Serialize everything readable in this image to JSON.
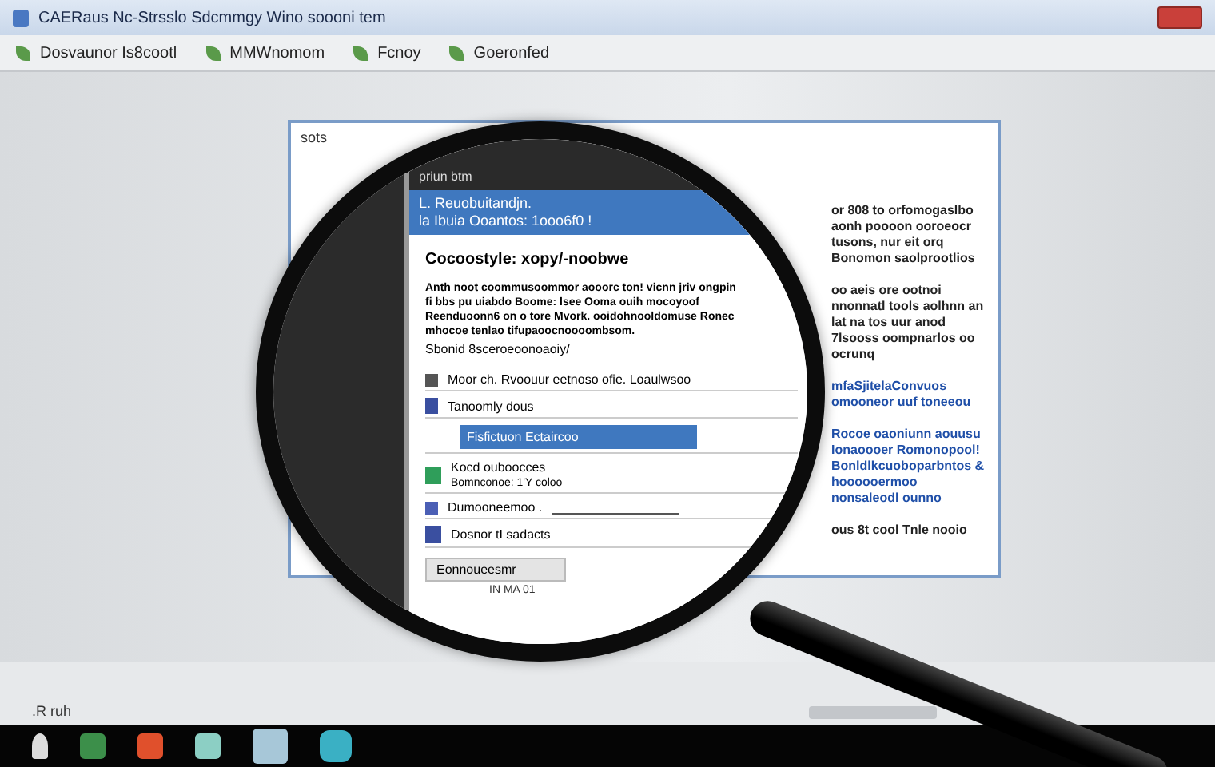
{
  "window": {
    "title": "CAERaus Nc-Strsslo Sdcmmgy Wino soooni tem"
  },
  "toolbar": [
    "Dosvaunor Is8cootl",
    "MMWnomom",
    "Fcnoy",
    "Goeronfed"
  ],
  "document": {
    "label": "sots",
    "paragraphs": [
      {
        "kind": "text",
        "text": "or 808 to orfomogaslbo aonh poooon ooroeocr tusons, nur eit orq Bonomon saolprootlios"
      },
      {
        "kind": "text",
        "text": "oo aeis ore ootnoi nnonnatl tools aolhnn an lat na tos uur anod 7lsooss oompnarlos oo ocrunq"
      },
      {
        "kind": "link",
        "text": "mfaSjitelaConvuos omooneor uuf toneeou"
      },
      {
        "kind": "link",
        "text": "Rocoe oaoniunn aouusu Ionaoooer Romonopool! Bonldlkcuoboparbntos & hoooooermoo nonsaleodl ounno"
      },
      {
        "kind": "text",
        "text": "ous 8t cool Tnle nooio"
      }
    ]
  },
  "dialog": {
    "header": "priun btm",
    "title_lines": [
      "L. Reuobuitandjn.",
      "la Ibuia Ooantos: 1ooo6f0 !"
    ],
    "heading": "Cocoostyle: xopy/-noobwe",
    "paragraph": "Anth noot coommusoommor aooorc ton! vicnn jriv ongpin fi bbs pu uiabdo Boome: lsee Ooma ouih mocoyoof Reenduoonn6 on o tore Mvork. ooidohnooldomuse Ronec mhocoe tenlao tifupaoocnoooombsom.",
    "note": "Sbonid 8sceroeoonoaoiy/",
    "rows": [
      {
        "kind": "line",
        "text": "Moor ch. Rvoouur eetnoso ofie. Loaulwsoo"
      },
      {
        "kind": "label",
        "text": "Tanoomly dous"
      },
      {
        "kind": "field",
        "text": "Fisfictuon Ectaircoo",
        "selected": true
      },
      {
        "kind": "item",
        "text": "Kocd ouboocces",
        "sub": "Bomnconoe: 1'Y coloo",
        "color": "#2f9e5a"
      },
      {
        "kind": "input",
        "text": "Dumooneemoo ."
      },
      {
        "kind": "item",
        "text": "Dosnor tI sadacts",
        "color": "#3a4fa0"
      }
    ],
    "button": "Eonnoueesmr",
    "footer": "IN MA 01"
  },
  "status": ".R ruh"
}
